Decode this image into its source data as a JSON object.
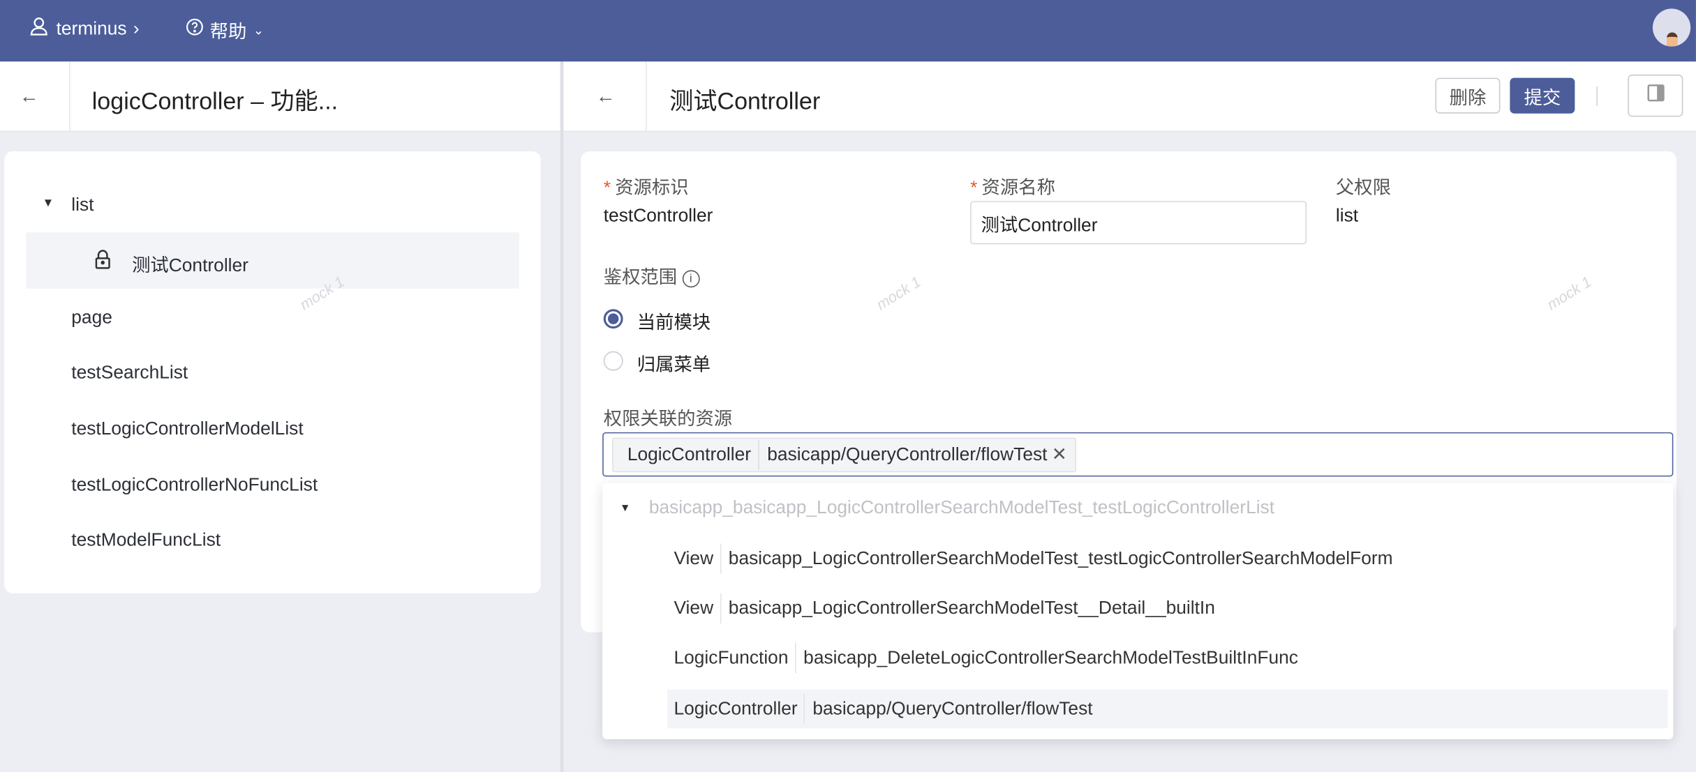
{
  "topbar": {
    "user": "terminus",
    "help": "帮助"
  },
  "left_panel": {
    "title": "logicController – 功能...",
    "tree": [
      {
        "label": "list",
        "expanded": true
      },
      {
        "label": "测试Controller",
        "icon": "lock-icon",
        "selected": true
      },
      {
        "label": "page"
      },
      {
        "label": "testSearchList"
      },
      {
        "label": "testLogicControllerModelList"
      },
      {
        "label": "testLogicControllerNoFuncList"
      },
      {
        "label": "testModelFuncList"
      }
    ]
  },
  "right_panel": {
    "title": "测试Controller",
    "delete_label": "删除",
    "submit_label": "提交",
    "form": {
      "resource_id_label": "资源标识",
      "resource_id_value": "testController",
      "resource_name_label": "资源名称",
      "resource_name_value": "测试Controller",
      "parent_label": "父权限",
      "parent_value": "list",
      "scope_label": "鉴权范围",
      "scope_options": [
        "当前模块",
        "归属菜单"
      ],
      "scope_selected": "当前模块",
      "related_label": "权限关联的资源",
      "selected_tag": {
        "type": "LogicController",
        "path": "basicapp/QueryController/flowTest"
      }
    },
    "dropdown": {
      "group": "basicapp_basicapp_LogicControllerSearchModelTest_testLogicControllerList",
      "options": [
        {
          "type": "View",
          "path": "basicapp_LogicControllerSearchModelTest_testLogicControllerSearchModelForm"
        },
        {
          "type": "View",
          "path": "basicapp_LogicControllerSearchModelTest__Detail__builtIn"
        },
        {
          "type": "LogicFunction",
          "path": "basicapp_DeleteLogicControllerSearchModelTestBuiltInFunc"
        },
        {
          "type": "LogicController",
          "path": "basicapp/QueryController/flowTest"
        }
      ]
    }
  },
  "watermark": "mock 1",
  "colors": {
    "primary": "#4c5d99",
    "required": "#e8562a",
    "background": "#eceef4"
  }
}
